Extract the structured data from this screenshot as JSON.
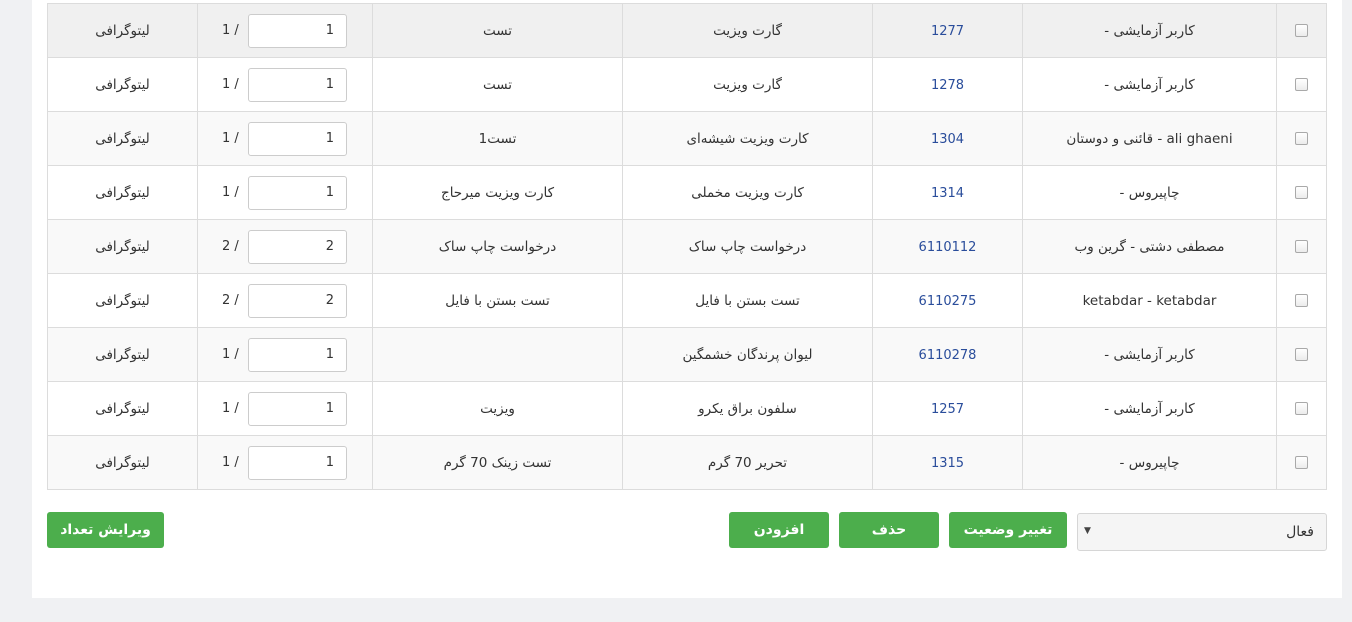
{
  "table": {
    "rows": [
      {
        "customer": "کاربر آزمایشی -",
        "code": "1277",
        "name": "گارت ویزیت",
        "desc": "تست",
        "qty": "1",
        "total": "1 /",
        "type": "لیتوگرافی"
      },
      {
        "customer": "کاربر آزمایشی -",
        "code": "1278",
        "name": "گارت ویزیت",
        "desc": "تست",
        "qty": "1",
        "total": "1 /",
        "type": "لیتوگرافی"
      },
      {
        "customer": "ali ghaeni - قائنی و دوستان",
        "code": "1304",
        "name": "کارت ویزیت شیشه‌ای",
        "desc": "تست1",
        "qty": "1",
        "total": "1 /",
        "type": "لیتوگرافی"
      },
      {
        "customer": "چاپیروس -",
        "code": "1314",
        "name": "کارت ویزیت مخملی",
        "desc": "کارت ویزیت میرحاج",
        "qty": "1",
        "total": "1 /",
        "type": "لیتوگرافی"
      },
      {
        "customer": "مصطفی دشتی - گرین وب",
        "code": "6110112",
        "name": "درخواست چاپ ساک",
        "desc": "درخواست چاپ ساک",
        "qty": "2",
        "total": "2 /",
        "type": "لیتوگرافی"
      },
      {
        "customer": "ketabdar - ketabdar",
        "code": "6110275",
        "name": "تست بستن با فایل",
        "desc": "تست بستن با فایل",
        "qty": "2",
        "total": "2 /",
        "type": "لیتوگرافی"
      },
      {
        "customer": "کاربر آزمایشی -",
        "code": "6110278",
        "name": "لیوان پرندگان خشمگین",
        "desc": "",
        "qty": "1",
        "total": "1 /",
        "type": "لیتوگرافی"
      },
      {
        "customer": "کاربر آزمایشی -",
        "code": "1257",
        "name": "سلفون براق یکرو",
        "desc": "ویزیت",
        "qty": "1",
        "total": "1 /",
        "type": "لیتوگرافی"
      },
      {
        "customer": "چاپیروس -",
        "code": "1315",
        "name": "تحریر 70 گرم",
        "desc": "تست زینک 70 گرم",
        "qty": "1",
        "total": "1 /",
        "type": "لیتوگرافی"
      }
    ]
  },
  "actions": {
    "edit_count_label": "ویرایش تعداد",
    "add_label": "افزودن",
    "delete_label": "حذف",
    "change_status_label": "تغییر وضعیت",
    "status_select_value": "فعال"
  },
  "colors": {
    "button_green": "#4cae4c",
    "code_link": "#2a4d9b"
  }
}
